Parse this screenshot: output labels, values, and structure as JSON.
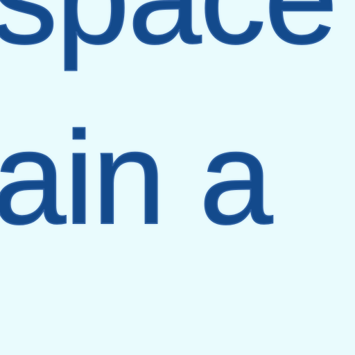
{
  "lines": [
    "space",
    "rain a"
  ]
}
